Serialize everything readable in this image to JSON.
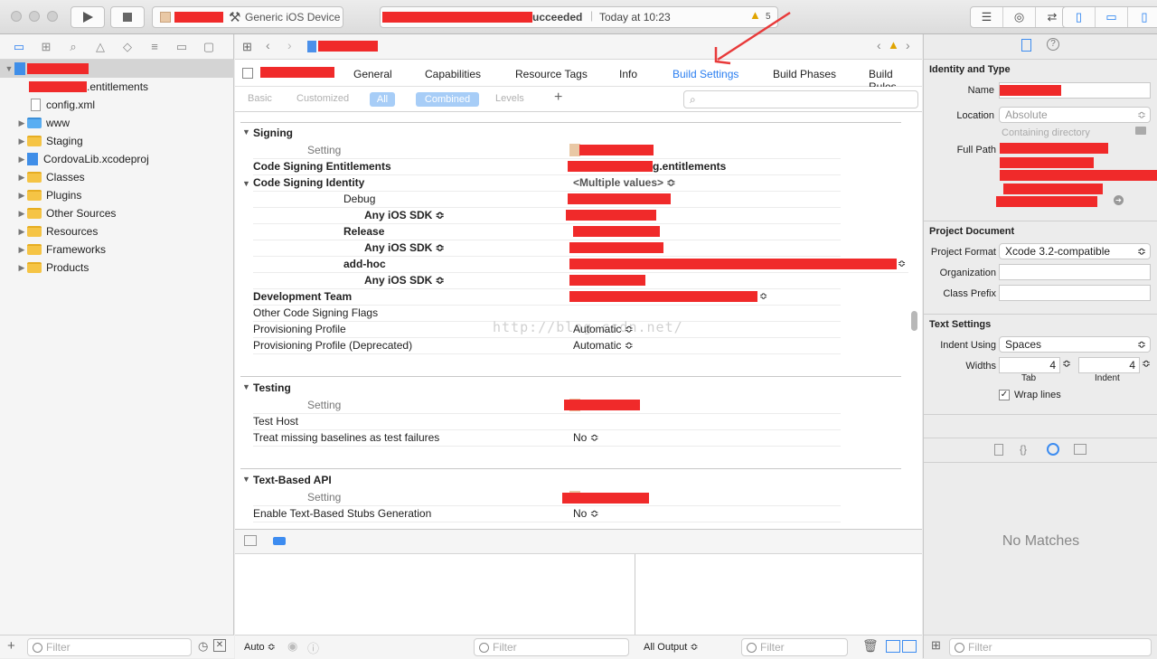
{
  "toolbar": {
    "scheme_device": "Generic iOS Device",
    "status_suffix": "ucceeded",
    "status_time": "Today at 10:23",
    "warning_count": "5"
  },
  "navigator": {
    "items": [
      {
        "label": ".entitlements"
      },
      {
        "label": "config.xml"
      },
      {
        "label": "www"
      },
      {
        "label": "Staging"
      },
      {
        "label": "CordovaLib.xcodeproj"
      },
      {
        "label": "Classes"
      },
      {
        "label": "Plugins"
      },
      {
        "label": "Other Sources"
      },
      {
        "label": "Resources"
      },
      {
        "label": "Frameworks"
      },
      {
        "label": "Products"
      }
    ],
    "filter_placeholder": "Filter"
  },
  "editor": {
    "tabs": [
      "General",
      "Capabilities",
      "Resource Tags",
      "Info",
      "Build Settings",
      "Build Phases",
      "Build Rules"
    ],
    "filters": {
      "basic": "Basic",
      "customized": "Customized",
      "all": "All",
      "combined": "Combined",
      "levels": "Levels"
    },
    "signing": {
      "title": "Signing",
      "setting_header": "Setting",
      "entitlements_label": "Code Signing Entitlements",
      "entitlements_value": "g.entitlements",
      "identity_label": "Code Signing Identity",
      "identity_value": "<Multiple values> ≎",
      "debug": "Debug",
      "any_sdk": "Any iOS SDK ≎",
      "release": "Release",
      "adhoc": "add-hoc",
      "team": "Development Team",
      "other_flags": "Other Code Signing Flags",
      "prov": "Provisioning Profile",
      "prov_value": "Automatic ≎",
      "prov_dep": "Provisioning Profile (Deprecated)",
      "prov_dep_value": "Automatic ≎"
    },
    "testing": {
      "title": "Testing",
      "setting_header": "Setting",
      "host": "Test Host",
      "baselines": "Treat missing baselines as test failures",
      "baselines_value": "No ≎"
    },
    "textapi": {
      "title": "Text-Based API",
      "setting_header": "Setting",
      "stubs": "Enable Text-Based Stubs Generation",
      "stubs_value": "No ≎"
    },
    "watermark": "http://blog.csdn.net/",
    "debug": {
      "auto": "Auto ≎",
      "filter_placeholder": "Filter",
      "all_output": "All Output ≎",
      "filter2_placeholder": "Filter"
    }
  },
  "inspector": {
    "identity": {
      "title": "Identity and Type",
      "name_label": "Name",
      "location_label": "Location",
      "location_value": "Absolute",
      "containing": "Containing directory",
      "fullpath_label": "Full Path"
    },
    "project_doc": {
      "title": "Project Document",
      "format_label": "Project Format",
      "format_value": "Xcode 3.2-compatible",
      "org_label": "Organization",
      "prefix_label": "Class Prefix"
    },
    "text_settings": {
      "title": "Text Settings",
      "indent_label": "Indent Using",
      "indent_value": "Spaces",
      "widths_label": "Widths",
      "tab_value": "4",
      "indent_width_value": "4",
      "tab_caption": "Tab",
      "indent_caption": "Indent",
      "wrap_label": "Wrap lines"
    },
    "library": {
      "no_matches": "No Matches",
      "filter_placeholder": "Filter"
    }
  }
}
